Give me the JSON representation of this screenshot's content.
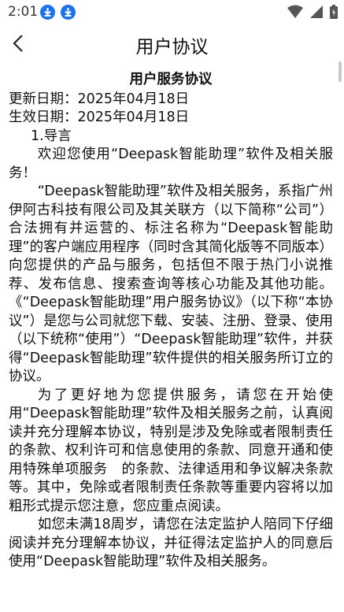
{
  "status_bar": {
    "time": "2:01",
    "icons": [
      "download-icon",
      "download-icon",
      "wifi-icon",
      "signal-icon",
      "battery-icon"
    ]
  },
  "app_bar": {
    "title": "用户协议",
    "back_icon": "chevron-left-icon"
  },
  "document": {
    "title": "用户服务协议",
    "updated": "更新日期：2025年04月18日",
    "effective": "生效日期：2025年04月18日",
    "section": "1.导言",
    "paragraphs": [
      "欢迎您使用“Deepask智能助理”软件及相关服务！",
      "“Deepask智能助理”软件及相关服务，系指广州伊阿古科技有限公司及其关联方（以下简称“公司”）合法拥有并运营的、标注名称为“Deepask智能助理”的客户端应用程序（同时含其简化版等不同版本）向您提供的产品与服务，包括但不限于热门小说推荐、发布信息、搜索查询等核心功能及其他功能。《“Deepask智能助理”用户服务协议》（以下称“本协议”）是您与公司就您下载、安装、注册、登录、使用（以下统称“使用”）“Deepask智能助理”软件，并获得“Deepask智能助理”软件提供的相关服务所订立的协议。",
      "为了更好地为您提供服务，请您在开始使用“Deepask智能助理”软件及相关服务之前，认真阅读并充分理解本协议，特别是涉及免除或者限制责任的条款、权利许可和信息使用的条款、同意开通和使用特殊单项服务　的条款、法律适用和争议解决条款等。其中，免除或者限制责任条款等重要内容将以加粗形式提示您注意，您应重点阅读。",
      "如您未满18周岁，请您在法定监护人陪同下仔细阅读并充分理解本协议，并征得法定监护人的同意后使用“Deepask智能助理”软件及相关服务。"
    ]
  },
  "colors": {
    "download_badge": "#1a73e8",
    "text": "#111111",
    "background": "#ffffff"
  }
}
